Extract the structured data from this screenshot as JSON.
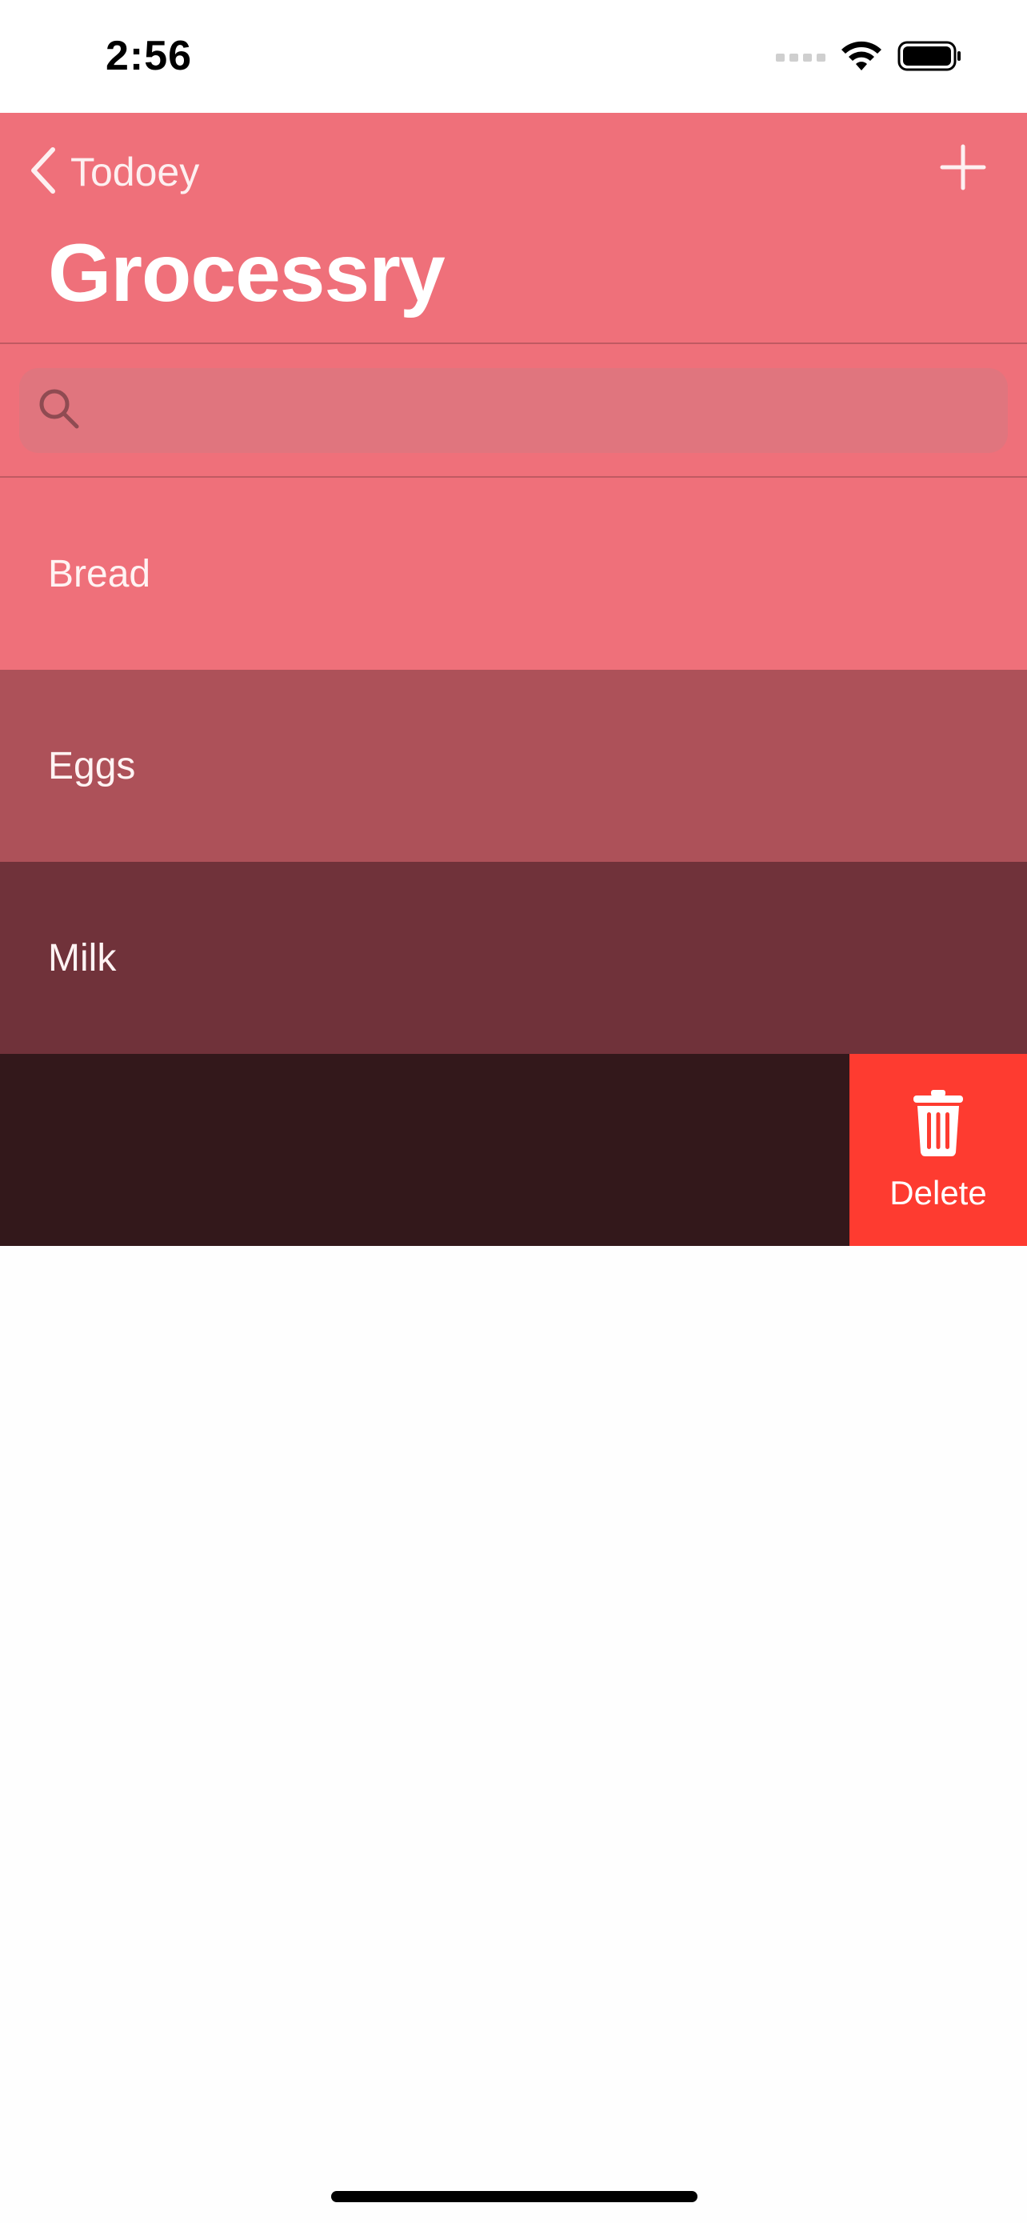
{
  "status_bar": {
    "time": "2:56",
    "icons": [
      "cellular-signal-icon",
      "wifi-icon",
      "battery-icon"
    ]
  },
  "nav": {
    "back_label": "Todoey",
    "back_icon": "chevron-left-icon",
    "add_icon": "plus-icon",
    "title": "Grocessry"
  },
  "search": {
    "icon": "search-icon",
    "placeholder": "",
    "value": ""
  },
  "items": [
    {
      "label": "Bread",
      "color": "#ef707a"
    },
    {
      "label": "Eggs",
      "color": "#ad5159"
    },
    {
      "label": "Milk",
      "color": "#70323a"
    },
    {
      "label": "",
      "color": "#33181b"
    }
  ],
  "swipe_action": {
    "label": "Delete",
    "icon": "trash-icon",
    "color": "#fe3b30"
  },
  "colors": {
    "nav_background": "#ef707a",
    "search_field": "#e0757e"
  }
}
